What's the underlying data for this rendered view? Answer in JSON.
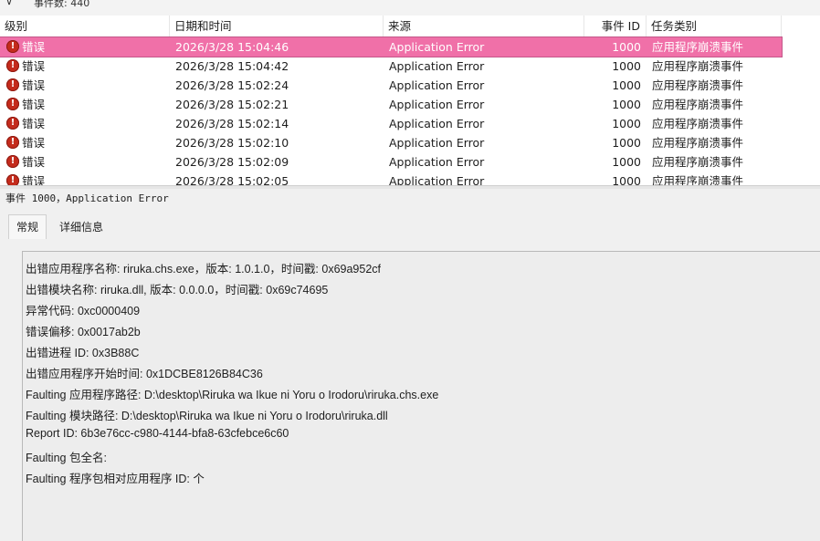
{
  "topbar": {
    "filter_icon": "filter-icon",
    "count_text": "事件数: 440"
  },
  "columns": {
    "level": "级别",
    "date": "日期和时间",
    "source": "来源",
    "event_id": "事件 ID",
    "task": "任务类别"
  },
  "rows": [
    {
      "level": "错误",
      "date": "2026/3/28 15:04:46",
      "source": "Application Error",
      "id": "1000",
      "task": "应用程序崩溃事件"
    },
    {
      "level": "错误",
      "date": "2026/3/28 15:04:42",
      "source": "Application Error",
      "id": "1000",
      "task": "应用程序崩溃事件"
    },
    {
      "level": "错误",
      "date": "2026/3/28 15:02:24",
      "source": "Application Error",
      "id": "1000",
      "task": "应用程序崩溃事件"
    },
    {
      "level": "错误",
      "date": "2026/3/28 15:02:21",
      "source": "Application Error",
      "id": "1000",
      "task": "应用程序崩溃事件"
    },
    {
      "level": "错误",
      "date": "2026/3/28 15:02:14",
      "source": "Application Error",
      "id": "1000",
      "task": "应用程序崩溃事件"
    },
    {
      "level": "错误",
      "date": "2026/3/28 15:02:10",
      "source": "Application Error",
      "id": "1000",
      "task": "应用程序崩溃事件"
    },
    {
      "level": "错误",
      "date": "2026/3/28 15:02:09",
      "source": "Application Error",
      "id": "1000",
      "task": "应用程序崩溃事件"
    },
    {
      "level": "错误",
      "date": "2026/3/28 15:02:05",
      "source": "Application Error",
      "id": "1000",
      "task": "应用程序崩溃事件"
    }
  ],
  "detail": {
    "title": "事件 1000，Application Error",
    "tabs": [
      "常规",
      "详细信息"
    ],
    "lines": [
      "出错应用程序名称:  riruka.chs.exe，版本:  1.0.1.0，时间戳:  0x69a952cf",
      "出错模块名称:  riruka.dll,  版本:  0.0.0.0，时间戳:  0x69c74695",
      "异常代码:  0xc0000409",
      "错误偏移:  0x0017ab2b",
      "出错进程 ID:  0x3B88C",
      "出错应用程序开始时间:  0x1DCBE8126B84C36",
      "Faulting 应用程序路径:  D:\\desktop\\Riruka wa Ikue ni Yoru o Irodoru\\riruka.chs.exe",
      "Faulting 模块路径:  D:\\desktop\\Riruka wa Ikue ni Yoru o Irodoru\\riruka.dll",
      "Report ID:  6b3e76cc-c980-4144-bfa8-63cfebce6c60",
      "Faulting 包全名:",
      "Faulting 程序包相对应用程序 ID:   个"
    ]
  },
  "colors": {
    "selected_row": "#f070a8",
    "error_icon": "#c42b1c"
  }
}
